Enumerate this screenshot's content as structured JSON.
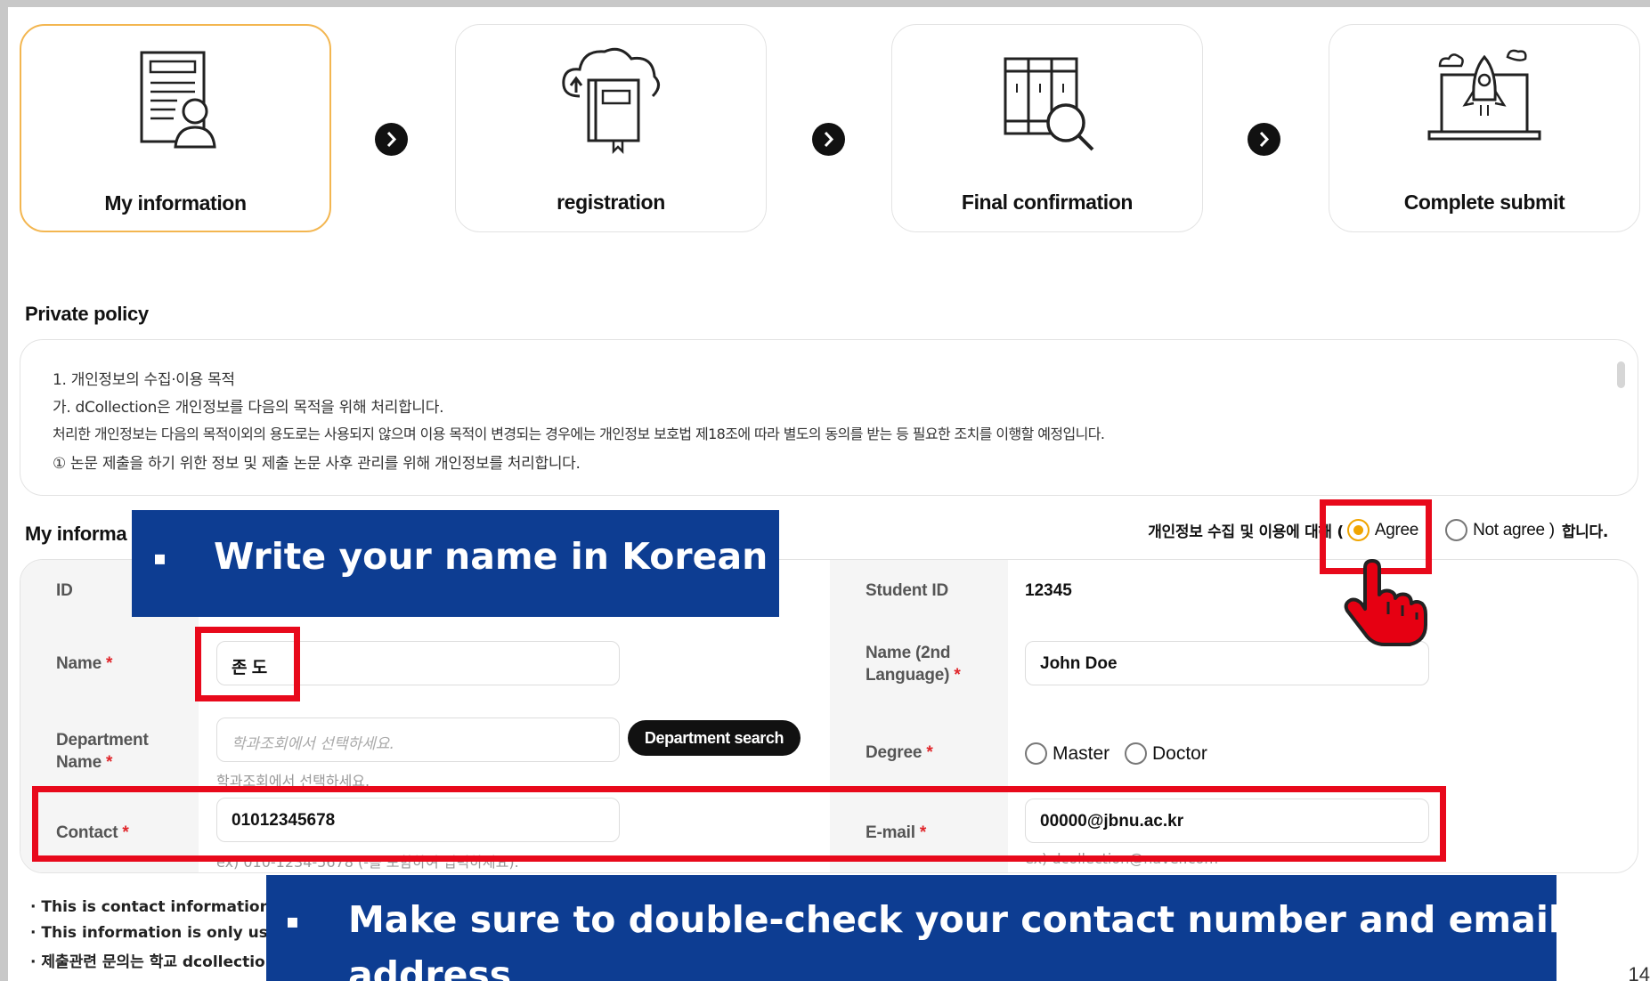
{
  "steps": [
    {
      "label": "My information",
      "icon": "document-person-icon",
      "active": true
    },
    {
      "label": "registration",
      "icon": "cloud-book-icon",
      "active": false
    },
    {
      "label": "Final confirmation",
      "icon": "shelf-magnifier-icon",
      "active": false
    },
    {
      "label": "Complete submit",
      "icon": "laptop-rocket-icon",
      "active": false
    }
  ],
  "policy": {
    "title": "Private policy",
    "lines": [
      "1. 개인정보의 수집·이용 목적",
      "가. dCollection은 개인정보를 다음의 목적을 위해 처리합니다.",
      "처리한 개인정보는 다음의 목적이외의 용도로는 사용되지 않으며 이용 목적이 변경되는 경우에는 개인정보 보호법 제18조에 따라 별도의 동의를 받는 등 필요한 조치를 이행할 예정입니다.",
      "① 논문 제출을 하기 위한 정보 및 제출 논문 사후 관리를 위해 개인정보를 처리합니다."
    ]
  },
  "consent": {
    "prefix": "개인정보 수집 및 이용에 대해 (",
    "agree": "Agree",
    "not_agree": "Not agree )",
    "suffix": "합니다."
  },
  "my_info": {
    "title": "My informa",
    "id_label": "ID",
    "name_label": "Name",
    "name_value": "존 도",
    "dept_label_1": "Department",
    "dept_label_2": "Name",
    "dept_placeholder": "학과조회에서 선택하세요.",
    "dept_helper": "학과조회에서 선택하세요.",
    "dept_button": "Department search",
    "contact_label": "Contact",
    "contact_value": "01012345678",
    "contact_helper": "ex) 010-1234-5678 (-를 포함하여 입력하세요).",
    "student_id_label": "Student ID",
    "student_id_value": "12345",
    "name2_label_1": "Name (2nd",
    "name2_label_2": "Language)",
    "name2_value": "John Doe",
    "degree_label": "Degree",
    "degree_options": [
      "Master",
      "Doctor"
    ],
    "email_label": "E-mail",
    "email_value": "00000@jbnu.ac.kr",
    "email_helper": "ex) dcollection@naver.com",
    "required_mark": "*"
  },
  "notes": [
    "· This is contact information r",
    "· This information is only used",
    "· 제출관련 문의는 학교 dcollectio"
  ],
  "overlays": {
    "bullet": "▪",
    "banner_1": "Write your name in Korean",
    "banner_2": "Make sure to double-check your contact number and email",
    "banner_2_cut": "address"
  },
  "page_number": "14",
  "colors": {
    "active_step_border": "#f3b650",
    "required": "#e0262b",
    "radio_selected": "#f0a500",
    "banner_bg": "#0d3d92",
    "highlight_red": "#e8091b"
  }
}
